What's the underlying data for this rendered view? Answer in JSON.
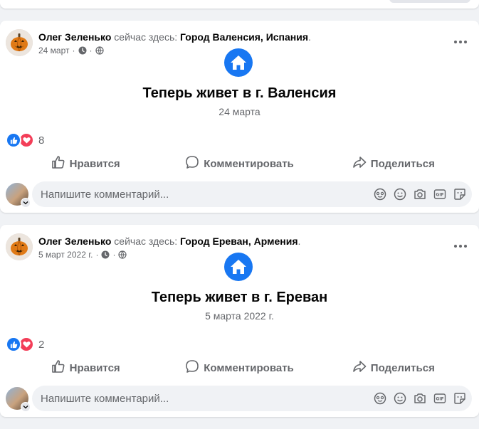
{
  "posts": [
    {
      "author": "Олег Зеленько",
      "checkin_text": " сейчас здесь: ",
      "place": "Город Валенсия, Испания",
      "place_end": ".",
      "date": "24 март",
      "sep1": "·",
      "sep2": "·",
      "life_event_title": "Теперь живет в г. Валенсия",
      "life_event_date": "24 марта",
      "reaction_count": "8",
      "actions": {
        "like": "Нравится",
        "comment": "Комментировать",
        "share": "Поделиться"
      },
      "comment_placeholder": "Напишите комментарий..."
    },
    {
      "author": "Олег Зеленько",
      "checkin_text": " сейчас здесь: ",
      "place": "Город Ереван, Армения",
      "place_end": ".",
      "date": "5 март 2022 г.",
      "sep1": "·",
      "sep2": "·",
      "life_event_title": "Теперь живет в г. Ереван",
      "life_event_date": "5 марта 2022 г.",
      "reaction_count": "2",
      "actions": {
        "like": "Нравится",
        "comment": "Комментировать",
        "share": "Поделиться"
      },
      "comment_placeholder": "Напишите комментарий..."
    }
  ],
  "icons": {
    "avatar": "pumpkin-avatar-icon",
    "privacy": "globe-icon",
    "time": "clock-icon",
    "life_event": "home-icon",
    "more": "more-dots-icon",
    "like_reaction": "like-reaction-icon",
    "love_reaction": "love-reaction-icon",
    "comment_tools": [
      "avatar-sticker-icon",
      "emoji-icon",
      "camera-icon",
      "gif-icon",
      "sticker-icon"
    ]
  },
  "colors": {
    "accent": "#1877f2",
    "love": "#f33e58",
    "secondary_text": "#65676b"
  }
}
